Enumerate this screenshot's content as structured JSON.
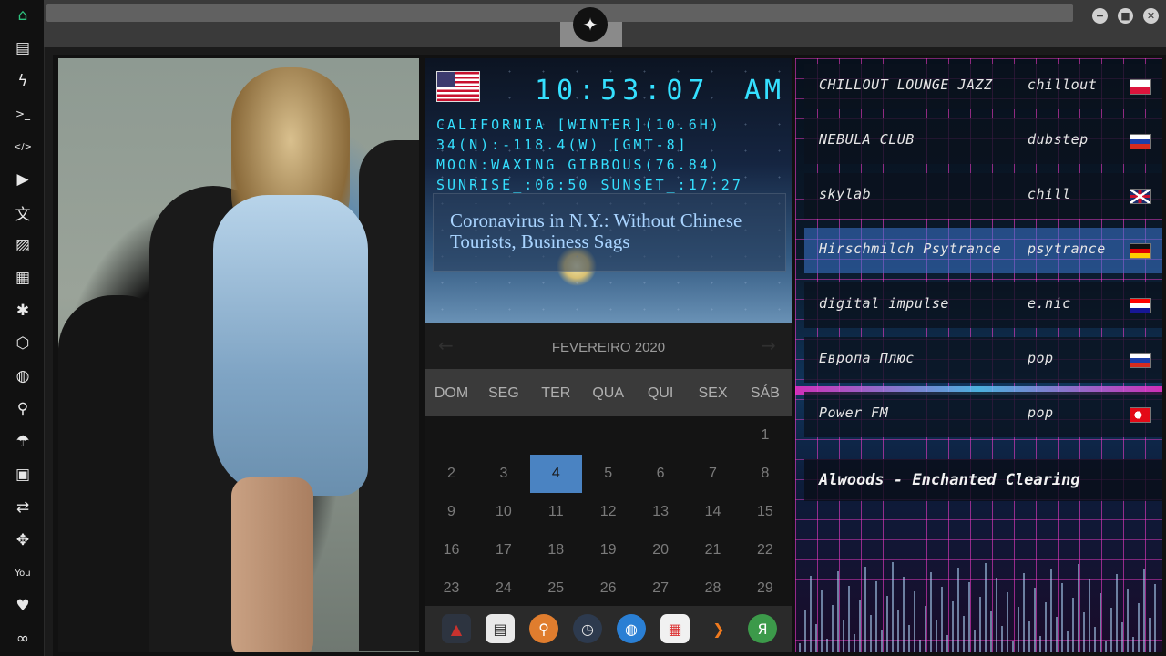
{
  "sidebar": {
    "icons": [
      {
        "name": "home-icon",
        "glyph": "⌂"
      },
      {
        "name": "document-icon",
        "glyph": "▤"
      },
      {
        "name": "lightning-icon",
        "glyph": "ϟ"
      },
      {
        "name": "terminal-icon",
        "glyph": ">_"
      },
      {
        "name": "code-icon",
        "glyph": "</>"
      },
      {
        "name": "play-icon",
        "glyph": "▶"
      },
      {
        "name": "translate-icon",
        "glyph": "文"
      },
      {
        "name": "image-icon",
        "glyph": "▨"
      },
      {
        "name": "news-icon",
        "glyph": "▦"
      },
      {
        "name": "asterisk-icon",
        "glyph": "✱"
      },
      {
        "name": "hexagon-icon",
        "glyph": "⬡"
      },
      {
        "name": "globe-icon",
        "glyph": "◍"
      },
      {
        "name": "search-icon",
        "glyph": "⚲"
      },
      {
        "name": "umbrella-icon",
        "glyph": "☂"
      },
      {
        "name": "contact-icon",
        "glyph": "▣"
      },
      {
        "name": "link-icon",
        "glyph": "⇄"
      },
      {
        "name": "expand-icon",
        "glyph": "✥"
      },
      {
        "name": "youtube-icon",
        "glyph": "You"
      },
      {
        "name": "heart-icon",
        "glyph": "♥"
      },
      {
        "name": "infinity-icon",
        "glyph": "∞"
      }
    ]
  },
  "window": {
    "minimize": "−",
    "maximize": "■",
    "close": "✕",
    "logo": "✦"
  },
  "clock": {
    "time": "10:53:07",
    "ampm": "AM",
    "line1": "CALIFORNIA [WINTER](10.6H)",
    "line2": "34(N):-118.4(W) [GMT-8]",
    "line3": "MOON:WAXING GIBBOUS(76.84)",
    "line4": "SUNRISE_:06:50 SUNSET_:17:27",
    "news": "Coronavirus in N.Y.: Without Chinese Tourists, Business Sags"
  },
  "calendar": {
    "month": "FEVEREIRO 2020",
    "prev": "←",
    "next": "→",
    "weekdays": [
      "DOM",
      "SEG",
      "TER",
      "QUA",
      "QUI",
      "SEX",
      "SÁB"
    ],
    "weeks": [
      [
        "",
        "",
        "",
        "",
        "",
        "",
        "1"
      ],
      [
        "2",
        "3",
        "4",
        "5",
        "6",
        "7",
        "8"
      ],
      [
        "9",
        "10",
        "11",
        "12",
        "13",
        "14",
        "15"
      ],
      [
        "16",
        "17",
        "18",
        "19",
        "20",
        "21",
        "22"
      ],
      [
        "23",
        "24",
        "25",
        "26",
        "27",
        "28",
        "29"
      ]
    ],
    "today": "4"
  },
  "dock": {
    "apps": [
      {
        "name": "app-red-triangle-icon",
        "glyph": "▲",
        "color": "#c8322e",
        "bg": "#2d3440"
      },
      {
        "name": "newspaper-icon",
        "glyph": "▤",
        "color": "#333",
        "bg": "#e9e9e9"
      },
      {
        "name": "magnifier-icon",
        "glyph": "⚲",
        "color": "#fff",
        "bg": "#e07d2e"
      },
      {
        "name": "clock-icon",
        "glyph": "◷",
        "color": "#eee",
        "bg": "#2d3a4e"
      },
      {
        "name": "globe-icon",
        "glyph": "◍",
        "color": "#fff",
        "bg": "#2a7fd4"
      },
      {
        "name": "calendar-icon",
        "glyph": "▦",
        "color": "#d33",
        "bg": "#f1f1f1"
      },
      {
        "name": "arrow-icon",
        "glyph": "❯",
        "color": "#f07a1e",
        "bg": "#2a2a2a"
      },
      {
        "name": "yandex-icon",
        "glyph": "Я",
        "color": "#fff",
        "bg": "#3c9a4a"
      }
    ]
  },
  "radio": {
    "stations": [
      {
        "name": "CHILLOUT LOUNGE JAZZ",
        "genre": "chillout",
        "flag": "pl"
      },
      {
        "name": "NEBULA CLUB",
        "genre": "dubstep",
        "flag": "ru"
      },
      {
        "name": "skylab",
        "genre": "chill",
        "flag": "gb"
      },
      {
        "name": "Hirschmilch Psytrance",
        "genre": "psytrance",
        "flag": "de"
      },
      {
        "name": "digital impulse",
        "genre": "e.nic",
        "flag": "hr"
      },
      {
        "name": "Европа Плюс",
        "genre": "pop",
        "flag": "ru"
      },
      {
        "name": "Power FM",
        "genre": "pop",
        "flag": "tr"
      }
    ],
    "selected_index": 3,
    "now_playing": "Alwoods - Enchanted Clearing"
  },
  "colors": {
    "accent_cyan": "#35e0ff",
    "today_blue": "#4a83c2",
    "active_green": "#2ec27e"
  }
}
